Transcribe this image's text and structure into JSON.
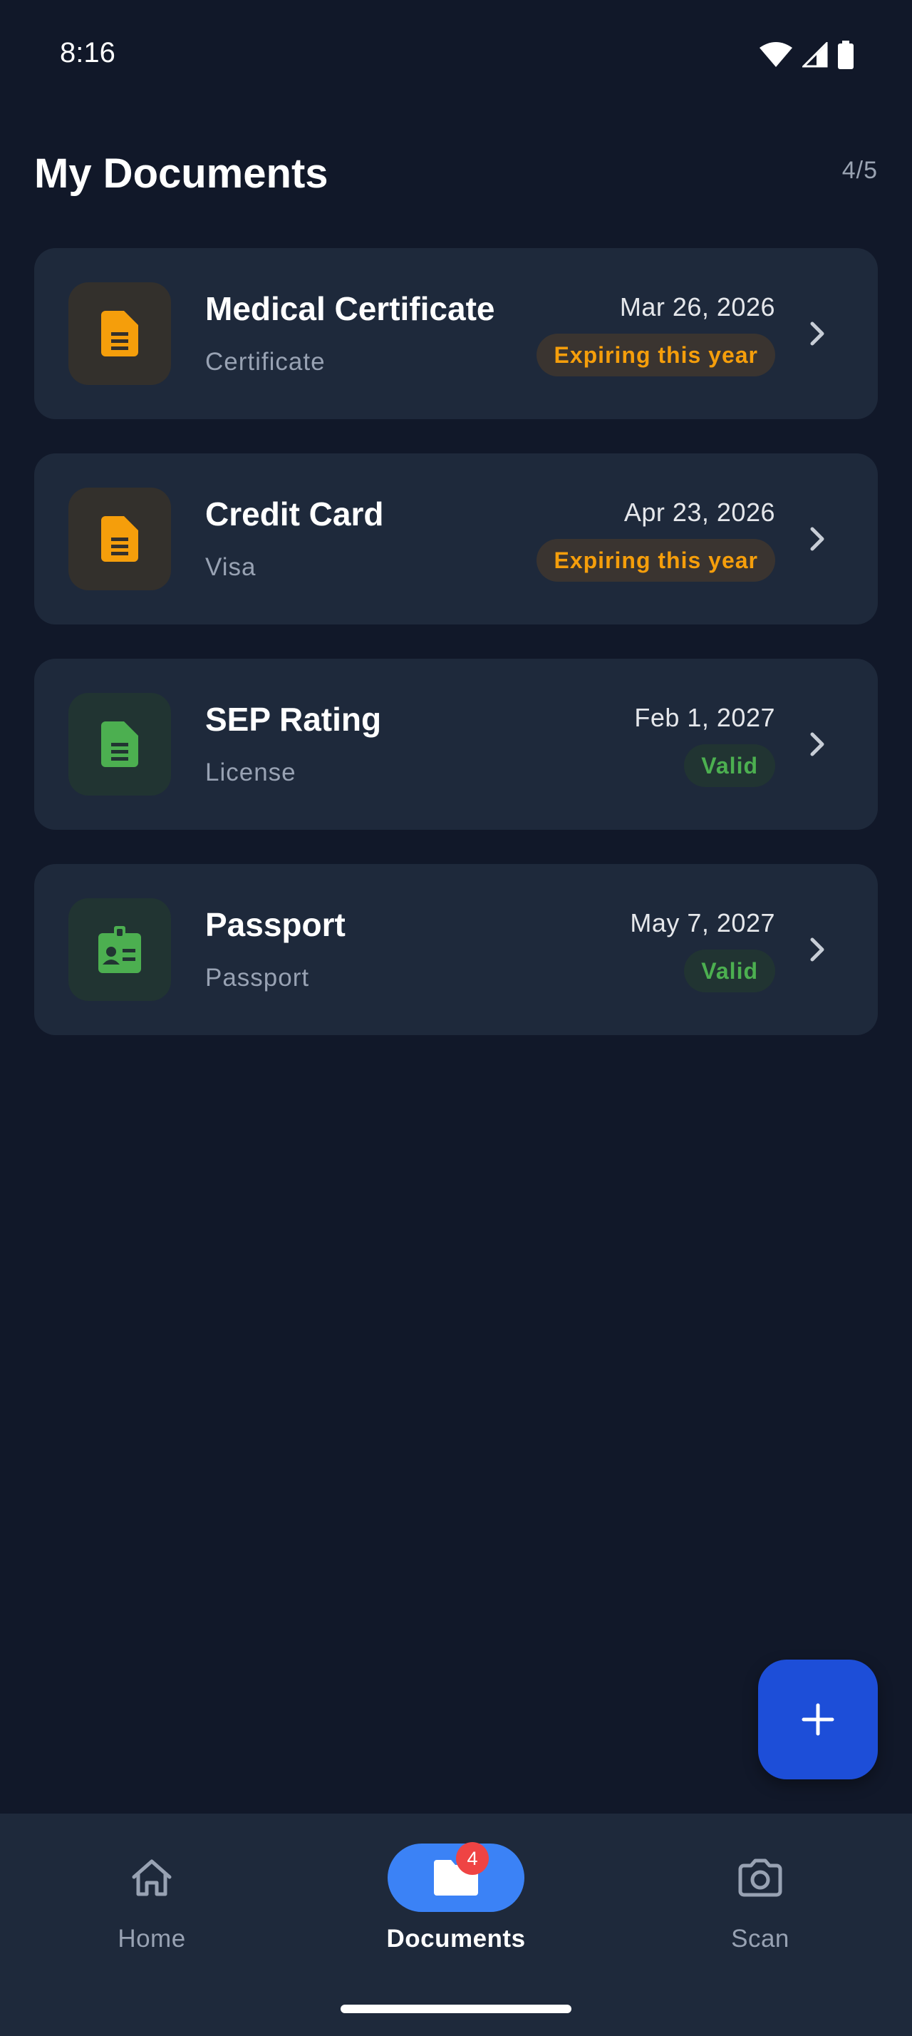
{
  "status_bar": {
    "time": "8:16"
  },
  "header": {
    "title": "My Documents",
    "counter": "4/5"
  },
  "documents": [
    {
      "name": "Medical Certificate",
      "type": "Certificate",
      "date": "Mar 26, 2026",
      "status": "Expiring this year"
    },
    {
      "name": "Credit Card",
      "type": "Visa",
      "date": "Apr 23, 2026",
      "status": "Expiring this year"
    },
    {
      "name": "SEP Rating",
      "type": "License",
      "date": "Feb 1, 2027",
      "status": "Valid"
    },
    {
      "name": "Passport",
      "type": "Passport",
      "date": "May 7, 2027",
      "status": "Valid"
    }
  ],
  "colors": {
    "background": "#111829",
    "card": "#1e293b",
    "warning": "#f59e0b",
    "valid": "#4caf50",
    "accent": "#3b82f6",
    "fab": "#1d4ed8",
    "badge": "#ef4444"
  },
  "icons": {
    "doc_1": "document-icon",
    "doc_2": "document-icon",
    "doc_3": "document-icon",
    "doc_4": "id-badge-icon",
    "fab": "plus-icon"
  },
  "nav": {
    "home_label": "Home",
    "documents_label": "Documents",
    "documents_badge": "4",
    "scan_label": "Scan",
    "active": "Documents"
  }
}
